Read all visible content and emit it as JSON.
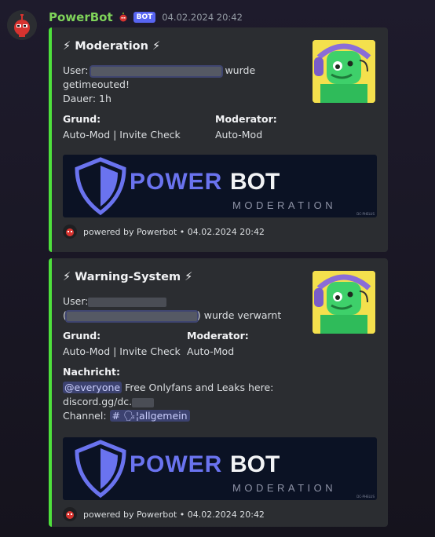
{
  "message": {
    "author": "PowerBot",
    "bot_tag": "BOT",
    "timestamp": "04.02.2024 20:42",
    "accent_color": "#4ee03c",
    "username_color": "#7fd35a"
  },
  "embeds": [
    {
      "title": "⚡ Moderation ⚡",
      "user_prefix": "User:",
      "user_suffix": "wurde",
      "line2": "getimeouted!",
      "duration": "Dauer: 1h",
      "reason_label": "Grund:",
      "reason_value": "Auto-Mod | Invite Check",
      "moderator_label": "Moderator:",
      "moderator_value": "Auto-Mod",
      "banner": {
        "word1": "POWER",
        "word2": "BOT",
        "tagline": "MODERATION",
        "credit": "DC-PHELUS"
      },
      "footer": "powered by Powerbot • 04.02.2024 20:42"
    },
    {
      "title": "⚡ Warning-System ⚡",
      "user_prefix": "User:",
      "user_line2_open": "(",
      "user_line2_suffix": ") wurde verwarnt",
      "reason_label": "Grund:",
      "reason_value": "Auto-Mod | Invite Check",
      "moderator_label": "Moderator:",
      "moderator_value": "Auto-Mod",
      "message_label": "Nachricht:",
      "mention": "@everyone",
      "message_text": "Free Onlyfans and Leaks here:",
      "link_prefix": "discord.gg/dc.",
      "channel_label": "Channel:",
      "channel_name": "# 🗣¦allgemein",
      "banner": {
        "word1": "POWER",
        "word2": "BOT",
        "tagline": "MODERATION",
        "credit": "DC-PHELUS"
      },
      "footer": "powered by Powerbot • 04.02.2024 20:42"
    }
  ],
  "icons": [
    "bot-avatar-icon",
    "cherry-badge-icon",
    "shield-icon",
    "lightning-icon"
  ]
}
